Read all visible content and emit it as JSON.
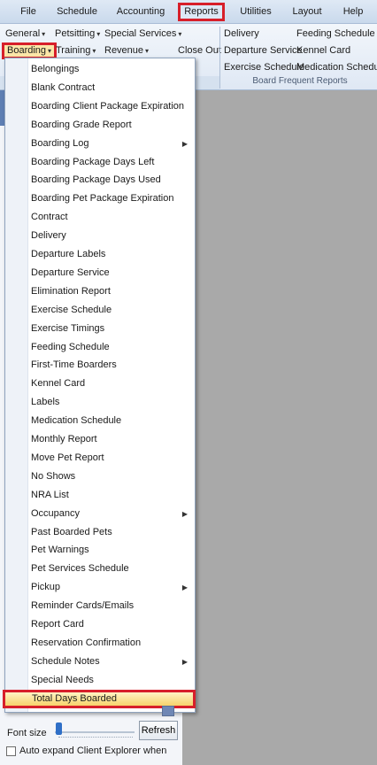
{
  "menubar": {
    "items": [
      {
        "label": "File"
      },
      {
        "label": "Schedule"
      },
      {
        "label": "Accounting"
      },
      {
        "label": "Reports"
      },
      {
        "label": "Utilities"
      },
      {
        "label": "Layout"
      },
      {
        "label": "Help"
      }
    ]
  },
  "ribbon": {
    "general": "General",
    "petsitting": "Petsitting",
    "special_services": "Special Services",
    "boarding": "Boarding",
    "training": "Training",
    "revenue": "Revenue",
    "close_out": "Close Out",
    "frequent": {
      "delivery": "Delivery",
      "feeding_schedule": "Feeding Schedule",
      "departure_service": "Departure Service",
      "kennel_card": "Kennel Card",
      "exercise_schedule": "Exercise Schedule",
      "medication_schedule": "Medication Schedule",
      "group_label": "Board Frequent Reports"
    }
  },
  "dropdown": {
    "items": [
      {
        "label": "Belongings",
        "submenu": false
      },
      {
        "label": "Blank Contract",
        "submenu": false
      },
      {
        "label": "Boarding Client Package Expiration",
        "submenu": false
      },
      {
        "label": "Boarding Grade Report",
        "submenu": false
      },
      {
        "label": "Boarding Log",
        "submenu": true
      },
      {
        "label": "Boarding Package Days Left",
        "submenu": false
      },
      {
        "label": "Boarding Package Days Used",
        "submenu": false
      },
      {
        "label": "Boarding Pet Package Expiration",
        "submenu": false
      },
      {
        "label": "Contract",
        "submenu": false
      },
      {
        "label": "Delivery",
        "submenu": false
      },
      {
        "label": "Departure Labels",
        "submenu": false
      },
      {
        "label": "Departure Service",
        "submenu": false
      },
      {
        "label": "Elimination Report",
        "submenu": false
      },
      {
        "label": "Exercise Schedule",
        "submenu": false
      },
      {
        "label": "Exercise Timings",
        "submenu": false
      },
      {
        "label": "Feeding Schedule",
        "submenu": false
      },
      {
        "label": "First-Time Boarders",
        "submenu": false
      },
      {
        "label": "Kennel Card",
        "submenu": false
      },
      {
        "label": "Labels",
        "submenu": false
      },
      {
        "label": "Medication Schedule",
        "submenu": false
      },
      {
        "label": "Monthly Report",
        "submenu": false
      },
      {
        "label": "Move Pet Report",
        "submenu": false
      },
      {
        "label": "No Shows",
        "submenu": false
      },
      {
        "label": "NRA List",
        "submenu": false
      },
      {
        "label": "Occupancy",
        "submenu": true
      },
      {
        "label": "Past Boarded Pets",
        "submenu": false
      },
      {
        "label": "Pet Warnings",
        "submenu": false
      },
      {
        "label": "Pet Services Schedule",
        "submenu": false
      },
      {
        "label": "Pickup",
        "submenu": true
      },
      {
        "label": "Reminder Cards/Emails",
        "submenu": false
      },
      {
        "label": "Report Card",
        "submenu": false
      },
      {
        "label": "Reservation Confirmation",
        "submenu": false
      },
      {
        "label": "Schedule Notes",
        "submenu": true
      },
      {
        "label": "Special Needs",
        "submenu": false
      },
      {
        "label": "Total Days Boarded",
        "submenu": false,
        "selected": true
      }
    ]
  },
  "bottom": {
    "font_size_label": "Font size",
    "refresh_label": "Refresh",
    "auto_expand_label": "Auto expand Client Explorer when"
  },
  "colors": {
    "highlight_border": "#d71f2a",
    "selected_bg": "#f7d36b",
    "pane_gray": "#a9a9a9"
  }
}
